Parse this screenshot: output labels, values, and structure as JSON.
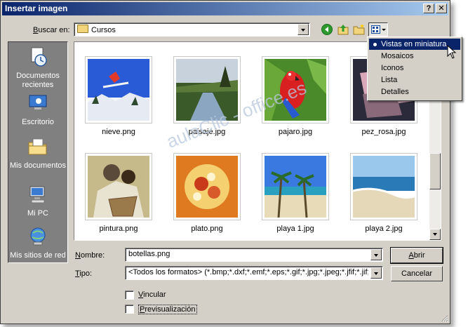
{
  "window": {
    "title": "Insertar imagen",
    "help_label": "?",
    "close_label": "✕"
  },
  "lookin": {
    "label_prefix": "B",
    "label_rest": "uscar en:",
    "value": "Cursos"
  },
  "toolbar": {
    "icons": [
      "back-icon",
      "up-folder-icon",
      "new-folder-icon",
      "views-icon"
    ]
  },
  "places": [
    {
      "label": "Documentos recientes"
    },
    {
      "label": "Escritorio"
    },
    {
      "label": "Mis documentos"
    },
    {
      "label": "Mi PC"
    },
    {
      "label": "Mis sitios de red"
    }
  ],
  "files": [
    {
      "name": "nieve.png"
    },
    {
      "name": "paisaje.jpg"
    },
    {
      "name": "pajaro.jpg"
    },
    {
      "name": "pez_rosa.jpg"
    },
    {
      "name": "pintura.png"
    },
    {
      "name": "plato.png"
    },
    {
      "name": "playa 1.jpg"
    },
    {
      "name": "playa 2.jpg"
    }
  ],
  "views_menu": {
    "items": [
      {
        "label": "Vistas en miniatura",
        "selected": true
      },
      {
        "label": "Mosaicos"
      },
      {
        "label": "Iconos"
      },
      {
        "label": "Lista"
      },
      {
        "label": "Detalles"
      }
    ]
  },
  "filename": {
    "label_prefix": "N",
    "label_rest": "ombre:",
    "value": "botellas.png"
  },
  "filetype": {
    "label_prefix": "T",
    "label_rest": "ipo:",
    "value": "<Todos los formatos> (*.bmp;*.dxf;*.emf;*.eps;*.gif;*.jpg;*.jpeg;*.jfif;*.jif;*.me"
  },
  "buttons": {
    "open_prefix": "A",
    "open_rest": "brir",
    "cancel": "Cancelar"
  },
  "options": {
    "link": {
      "label_prefix": "V",
      "label_rest": "incular",
      "checked": false
    },
    "preview": {
      "label_prefix": "P",
      "label_rest": "revisualización",
      "checked": false
    }
  },
  "watermark": "aulaClic - office.es",
  "colors": {
    "title_start": "#0a246a",
    "title_end": "#a6caf0",
    "selection": "#0a246a",
    "dialog_bg": "#d4d0c8"
  }
}
